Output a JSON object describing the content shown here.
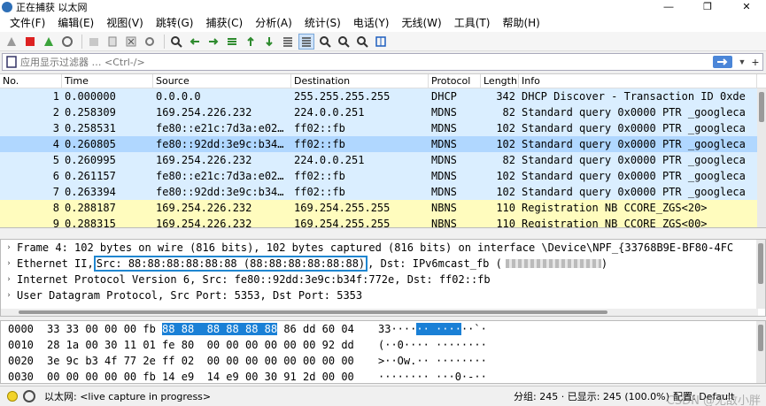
{
  "window": {
    "title": "正在捕获 以太网",
    "controls": [
      "—",
      "❐",
      "✕"
    ]
  },
  "menu": [
    "文件(F)",
    "编辑(E)",
    "视图(V)",
    "跳转(G)",
    "捕获(C)",
    "分析(A)",
    "统计(S)",
    "电话(Y)",
    "无线(W)",
    "工具(T)",
    "帮助(H)"
  ],
  "toolbar": {
    "icons": [
      "shark-fin-icon",
      "stop-icon",
      "restart-icon",
      "capture-options-icon",
      "open-file-icon",
      "save-file-icon",
      "close-file-icon",
      "reload-icon",
      "find-icon",
      "go-back-icon",
      "go-forward-icon",
      "go-to-packet-icon",
      "first-packet-icon",
      "last-packet-icon",
      "autoscroll-icon",
      "colorize-icon",
      "zoom-in-icon",
      "zoom-out-icon",
      "zoom-reset-icon",
      "resize-columns-icon"
    ]
  },
  "filter": {
    "placeholder": "应用显示过滤器 … <Ctrl-/>"
  },
  "columns": [
    "No.",
    "Time",
    "Source",
    "Destination",
    "Protocol",
    "Length",
    "Info"
  ],
  "colors": {
    "udp_row": "#daeeff",
    "selected_row": "#b0d7ff",
    "nbns_row": "#fffcbe",
    "selection": "#1a80d6",
    "highlight_box": "#1f86d0"
  },
  "packets": [
    {
      "no": "1",
      "time": "0.000000",
      "src": "0.0.0.0",
      "dst": "255.255.255.255",
      "proto": "DHCP",
      "len": "342",
      "info": "DHCP Discover - Transaction ID 0xde",
      "bg": "#daeeff"
    },
    {
      "no": "2",
      "time": "0.258309",
      "src": "169.254.226.232",
      "dst": "224.0.0.251",
      "proto": "MDNS",
      "len": "82",
      "info": "Standard query 0x0000 PTR _googleca",
      "bg": "#daeeff"
    },
    {
      "no": "3",
      "time": "0.258531",
      "src": "fe80::e21c:7d3a:e02…",
      "dst": "ff02::fb",
      "proto": "MDNS",
      "len": "102",
      "info": "Standard query 0x0000 PTR _googleca",
      "bg": "#daeeff"
    },
    {
      "no": "4",
      "time": "0.260805",
      "src": "fe80::92dd:3e9c:b34…",
      "dst": "ff02::fb",
      "proto": "MDNS",
      "len": "102",
      "info": "Standard query 0x0000 PTR _googleca",
      "bg": "#b0d7ff"
    },
    {
      "no": "5",
      "time": "0.260995",
      "src": "169.254.226.232",
      "dst": "224.0.0.251",
      "proto": "MDNS",
      "len": "82",
      "info": "Standard query 0x0000 PTR _googleca",
      "bg": "#daeeff"
    },
    {
      "no": "6",
      "time": "0.261157",
      "src": "fe80::e21c:7d3a:e02…",
      "dst": "ff02::fb",
      "proto": "MDNS",
      "len": "102",
      "info": "Standard query 0x0000 PTR _googleca",
      "bg": "#daeeff"
    },
    {
      "no": "7",
      "time": "0.263394",
      "src": "fe80::92dd:3e9c:b34…",
      "dst": "ff02::fb",
      "proto": "MDNS",
      "len": "102",
      "info": "Standard query 0x0000 PTR _googleca",
      "bg": "#daeeff"
    },
    {
      "no": "8",
      "time": "0.288187",
      "src": "169.254.226.232",
      "dst": "169.254.255.255",
      "proto": "NBNS",
      "len": "110",
      "info": "Registration NB CCORE_ZGS<20>",
      "bg": "#fffcbe"
    },
    {
      "no": "9",
      "time": "0.288315",
      "src": "169.254.226.232",
      "dst": "169.254.255.255",
      "proto": "NBNS",
      "len": "110",
      "info": "Registration NB CCORE_ZGS<00>",
      "bg": "#fffcbe"
    }
  ],
  "details": {
    "frame": "Frame 4: 102 bytes on wire (816 bits), 102 bytes captured (816 bits) on interface \\Device\\NPF_{33768B9E-BF80-4FC",
    "eth_prefix": "Ethernet II, ",
    "eth_src": "Src: 88:88:88:88:88:88 (88:88:88:88:88:88)",
    "eth_dst": ", Dst: IPv6mcast_fb (",
    "eth_tail": ")",
    "ipv6": "Internet Protocol Version 6, Src: fe80::92dd:3e9c:b34f:772e, Dst: ff02::fb",
    "udp": "User Datagram Protocol, Src Port: 5353, Dst Port: 5353"
  },
  "bytes": [
    {
      "offset": "0000",
      "hex_pre": "33 33 00 00 00 fb ",
      "hex_sel": "88 88  88 88 88 88",
      "hex_post": " 86 dd 60 04",
      "asc_pre": "33····",
      "asc_sel": "·· ····",
      "asc_post": "··`·"
    },
    {
      "offset": "0010",
      "hex_pre": "28 1a 00 30 11 01 fe 80  00 00 00 00 00 00 92 dd",
      "hex_sel": "",
      "hex_post": "",
      "asc_pre": "(··0···· ········",
      "asc_sel": "",
      "asc_post": ""
    },
    {
      "offset": "0020",
      "hex_pre": "3e 9c b3 4f 77 2e ff 02  00 00 00 00 00 00 00 00",
      "hex_sel": "",
      "hex_post": "",
      "asc_pre": ">··Ow.·· ········",
      "asc_sel": "",
      "asc_post": ""
    },
    {
      "offset": "0030",
      "hex_pre": "00 00 00 00 00 fb 14 e9  14 e9 00 30 91 2d 00 00",
      "hex_sel": "",
      "hex_post": "",
      "asc_pre": "········ ···0·-··",
      "asc_sel": "",
      "asc_post": ""
    }
  ],
  "status": {
    "interface": "以太网: <live capture in progress>",
    "groups": "分组: 245 · 已显示: 245 (100.0%)",
    "profile": "配置: Default",
    "watermark": "CSDN @无敌小胖"
  }
}
